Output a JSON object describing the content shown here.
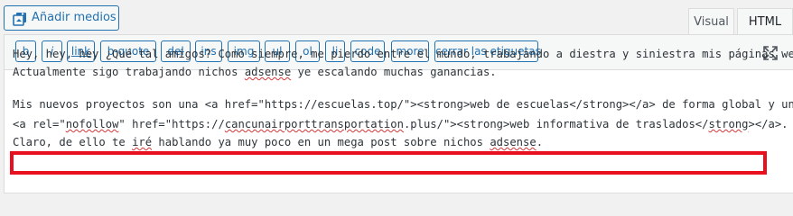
{
  "media_button": {
    "label": "Añadir medios",
    "icon": "media-icon"
  },
  "tabs": {
    "visual": "Visual",
    "html": "HTML"
  },
  "toolbar": {
    "buttons": [
      {
        "label": "b",
        "style": "bold"
      },
      {
        "label": "i",
        "style": "italic"
      },
      {
        "label": "link",
        "style": "underline"
      },
      {
        "label": "b-quote",
        "style": "normal"
      },
      {
        "label": "del",
        "style": "strike"
      },
      {
        "label": "ins",
        "style": "normal"
      },
      {
        "label": "img",
        "style": "normal"
      },
      {
        "label": "ul",
        "style": "normal"
      },
      {
        "label": "ol",
        "style": "normal"
      },
      {
        "label": "li",
        "style": "normal"
      },
      {
        "label": "code",
        "style": "normal"
      },
      {
        "label": "more",
        "style": "normal"
      },
      {
        "label": "cerrar las etiquetas",
        "style": "normal"
      }
    ],
    "fullscreen_icon": "fullscreen-icon"
  },
  "content": {
    "p1": {
      "a": "Hey, hey, hey ¿Qué tal amigos? Como siempre, me pierdo entre el mundo, trabajando a diestra y siniestra mis páginas web.",
      "b1": "Actualmente sigo trabajando nichos ",
      "b_sq": "adsense",
      "b2": " ye escalando muchas ganancias."
    },
    "p2": {
      "a": "Mis nuevos proyectos son una <a href=\"https://escuelas.top/\"><strong>web de escuelas</strong></a> de forma global y una",
      "b1": "<a rel=\"",
      "b_sq": "nofollow",
      "b2": "\" href=\"https://",
      "b_sq2": "cancunairporttransportation",
      "b3": ".plus/\"><strong>web informativa de traslados</",
      "b_sq3": "strong",
      "b4": "></a>.",
      "c1": "Claro, de ello te ",
      "c_sq": "iré",
      "c2": " hablando ya muy poco en un mega post sobre nichos ",
      "c_sq2": "adsense",
      "c3": "."
    }
  },
  "colors": {
    "accent": "#2271b1",
    "highlight": "#e8101e"
  }
}
